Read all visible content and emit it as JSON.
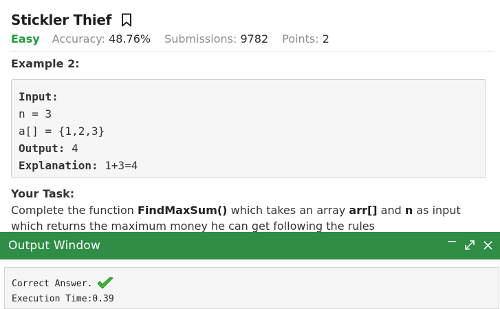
{
  "problem": {
    "title": "Stickler Thief",
    "difficulty": "Easy",
    "accuracy_label": "Accuracy:",
    "accuracy_value": "48.76%",
    "submissions_label": "Submissions:",
    "submissions_value": "9782",
    "points_label": "Points:",
    "points_value": "2"
  },
  "example": {
    "heading": "Example 2:",
    "input_label": "Input:",
    "line1": "n = 3",
    "line2": "a[] = {1,2,3}",
    "output_label": "Output:",
    "output_value": " 4",
    "explanation_label": "Explanation:",
    "explanation_value": " 1+3=4"
  },
  "task": {
    "heading": "Your Task:",
    "t1": "Complete the function ",
    "func": "FindMaxSum()",
    "t2": " which takes an array ",
    "arr": "arr[]",
    "t3": " and ",
    "n": "n",
    "t4": " as input which returns the maximum money he can get following the rules"
  },
  "output_window": {
    "title": "Output Window",
    "result": "Correct Answer.",
    "execution": "Execution Time:0.39"
  },
  "colors": {
    "accent": "#2f8d46",
    "easy": "#1f9d3f",
    "check": "#3cb832"
  }
}
